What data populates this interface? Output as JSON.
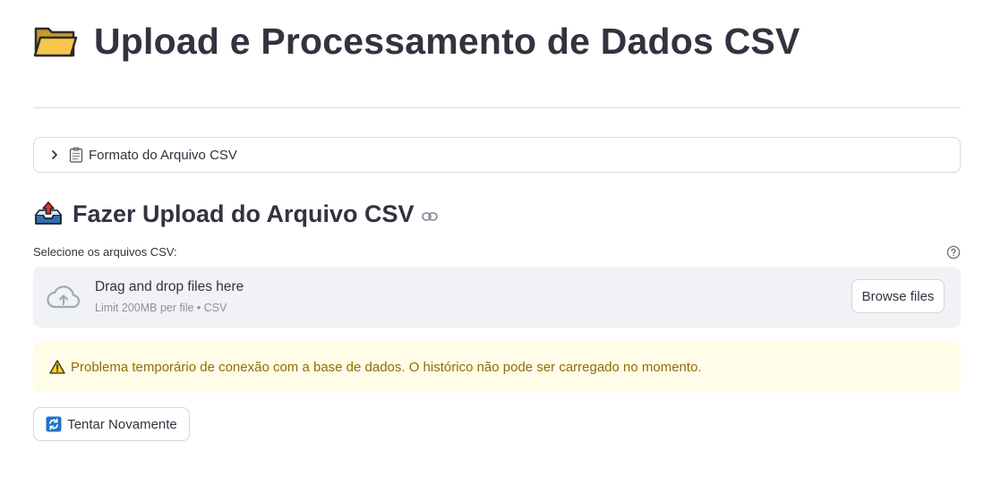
{
  "header": {
    "title": "Upload e Processamento de Dados CSV",
    "title_icon": "open-folder-icon"
  },
  "expander": {
    "label": "Formato do Arquivo CSV",
    "icon": "clipboard-icon",
    "expanded": false
  },
  "upload_section": {
    "heading": "Fazer Upload do Arquivo CSV",
    "heading_icon": "outbox-tray-icon",
    "uploader_label": "Selecione os arquivos CSV:",
    "dropzone_text": "Drag and drop files here",
    "dropzone_limit": "Limit 200MB per file • CSV",
    "browse_label": "Browse files"
  },
  "warning": {
    "text": "Problema temporário de conexão com a base de dados. O histórico não pode ser carregado no momento.",
    "icon": "warning-icon"
  },
  "retry_button": {
    "label": "Tentar Novamente",
    "icon": "refresh-icon"
  },
  "colors": {
    "text": "#31333f",
    "dropzone_bg": "#f0f2f6",
    "warning_bg": "#fffce7",
    "warning_text": "#926c05",
    "border": "#dcdce0"
  }
}
